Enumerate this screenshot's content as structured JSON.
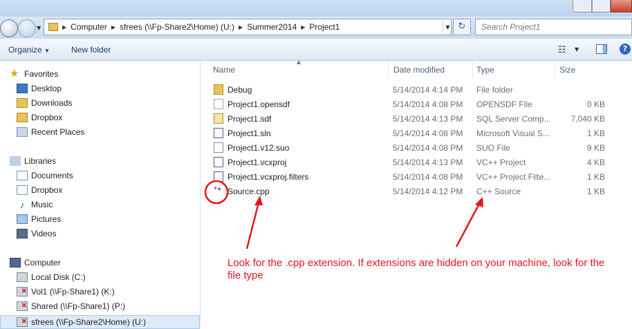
{
  "address": {
    "crumbs": [
      "Computer",
      "sfrees (\\\\Fp-Share2\\Home) (U:)",
      "Summer2014",
      "Project1"
    ],
    "search_placeholder": "Search Project1"
  },
  "toolbar": {
    "organize_label": "Organize",
    "new_folder_label": "New folder"
  },
  "nav": {
    "favorites_header": "Favorites",
    "favorites": [
      "Desktop",
      "Downloads",
      "Dropbox",
      "Recent Places"
    ],
    "libraries_header": "Libraries",
    "libraries": [
      "Documents",
      "Dropbox",
      "Music",
      "Pictures",
      "Videos"
    ],
    "computer_header": "Computer",
    "drives": [
      "Local Disk (C:)",
      "Vol1 (\\\\Fp-Share1) (K:)",
      "Shared (\\\\Fp-Share1) (P:)",
      "sfrees (\\\\Fp-Share2\\Home) (U:)"
    ]
  },
  "columns": {
    "name": "Name",
    "date": "Date modified",
    "type": "Type",
    "size": "Size"
  },
  "files": [
    {
      "name": "Debug",
      "date": "5/14/2014 4:14 PM",
      "type": "File folder",
      "size": "",
      "icon": "folder-icon"
    },
    {
      "name": "Project1.opensdf",
      "date": "5/14/2014 4:08 PM",
      "type": "OPENSDF File",
      "size": "0 KB",
      "icon": "blank-file-icon"
    },
    {
      "name": "Project1.sdf",
      "date": "5/14/2014 4:13 PM",
      "type": "SQL Server Comp...",
      "size": "7,040 KB",
      "icon": "sdf-file-icon"
    },
    {
      "name": "Project1.sln",
      "date": "5/14/2014 4:08 PM",
      "type": "Microsoft Visual S...",
      "size": "1 KB",
      "icon": "sln-file-icon"
    },
    {
      "name": "Project1.v12.suo",
      "date": "5/14/2014 4:08 PM",
      "type": "SUO File",
      "size": "9 KB",
      "icon": "suo-file-icon"
    },
    {
      "name": "Project1.vcxproj",
      "date": "5/14/2014 4:13 PM",
      "type": "VC++ Project",
      "size": "4 KB",
      "icon": "vcxproj-file-icon"
    },
    {
      "name": "Project1.vcxproj.filters",
      "date": "5/14/2014 4:08 PM",
      "type": "VC++ Project Filte...",
      "size": "1 KB",
      "icon": "filters-file-icon"
    },
    {
      "name": "Source.cpp",
      "date": "5/14/2014 4:12 PM",
      "type": "C++ Source",
      "size": "1 KB",
      "icon": "cpp-file-icon"
    }
  ],
  "annotation": "Look for the .cpp extension.  If extensions are hidden on your machine, look for the file type",
  "colors": {
    "annotation": "#e8141c",
    "selection": "#ddebf9",
    "title_bar": "#bcd3ee"
  }
}
